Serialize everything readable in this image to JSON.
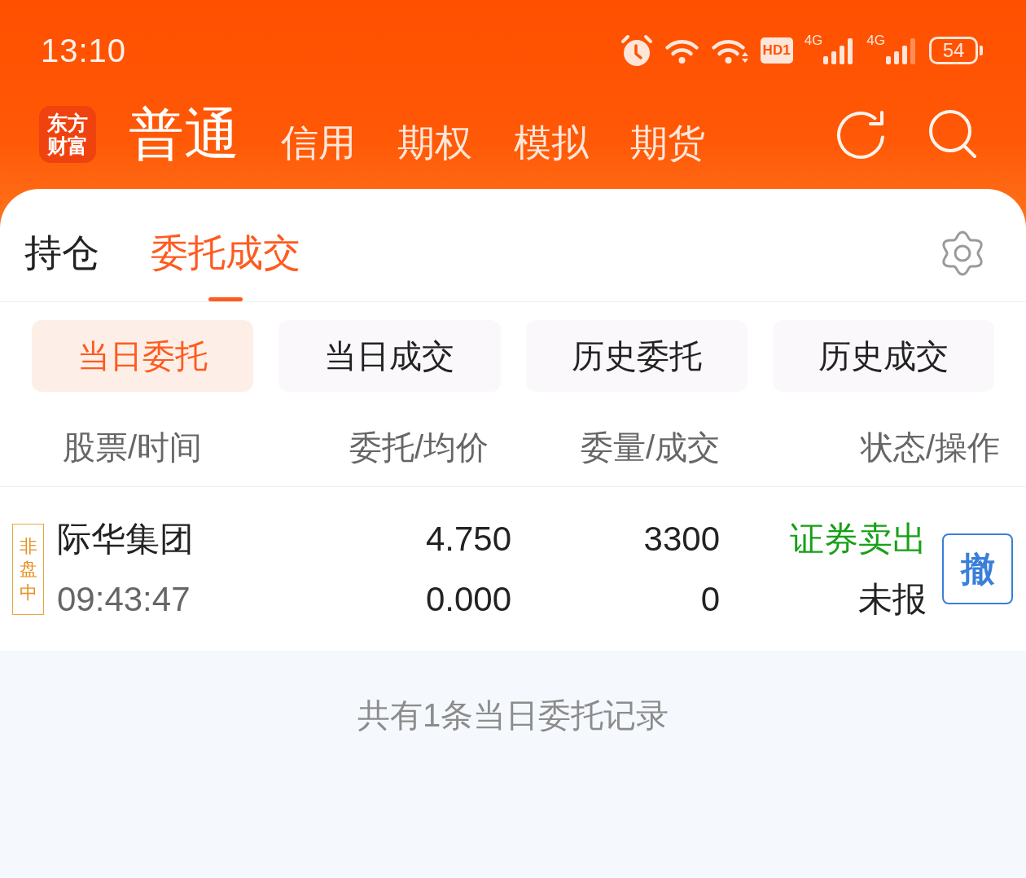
{
  "status_bar": {
    "time": "13:10",
    "hd_label": "HD1",
    "networks": [
      {
        "type": "4G"
      },
      {
        "type": "4G"
      }
    ],
    "battery": "54"
  },
  "header": {
    "logo": [
      "东方",
      "财富"
    ],
    "account_tabs": [
      {
        "label": "普通",
        "selected": true
      },
      {
        "label": "信用",
        "selected": false
      },
      {
        "label": "期权",
        "selected": false
      },
      {
        "label": "模拟",
        "selected": false
      },
      {
        "label": "期货",
        "selected": false
      }
    ]
  },
  "tabs": [
    {
      "label": "持仓",
      "selected": false
    },
    {
      "label": "委托成交",
      "selected": true
    }
  ],
  "sub_tabs": [
    {
      "label": "当日委托",
      "selected": true
    },
    {
      "label": "当日成交",
      "selected": false
    },
    {
      "label": "历史委托",
      "selected": false
    },
    {
      "label": "历史成交",
      "selected": false
    }
  ],
  "table": {
    "columns": [
      "股票/时间",
      "委托/均价",
      "委量/成交",
      "状态/操作"
    ],
    "rows": [
      {
        "session": "非盘中",
        "name": "际华集团",
        "time": "09:43:47",
        "order_price": "4.750",
        "avg_price": "0.000",
        "order_qty": "3300",
        "filled_qty": "0",
        "direction": {
          "label": "证券卖出",
          "color": "#17a017"
        },
        "status": "未报",
        "cancel": "撤"
      }
    ]
  },
  "summary": "共有1条当日委托记录"
}
